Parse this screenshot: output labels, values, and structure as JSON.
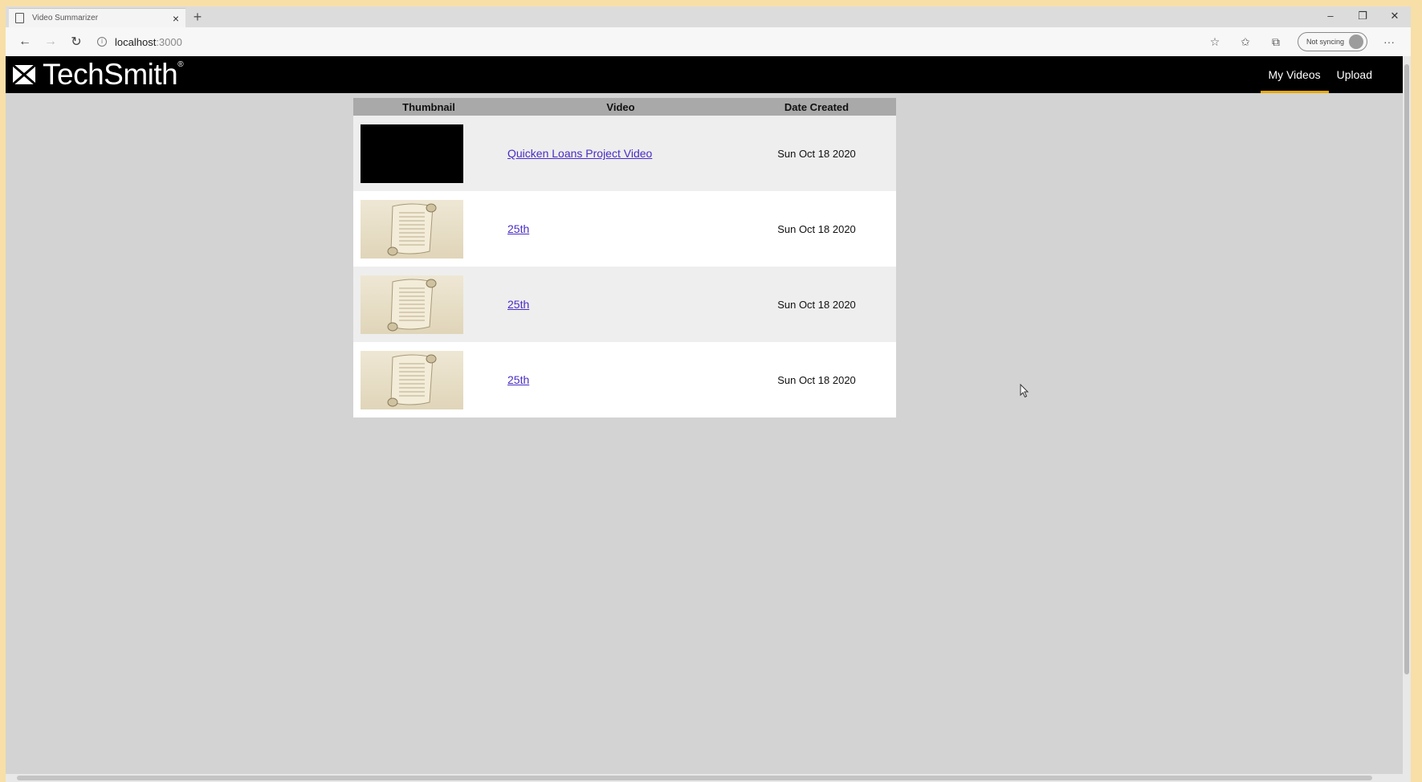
{
  "browser": {
    "tab_title": "Video Summarizer",
    "url_host": "localhost",
    "url_port": ":3000",
    "sync_label": "Not syncing",
    "tab_close_glyph": "×",
    "new_tab_glyph": "+",
    "back_glyph": "←",
    "forward_glyph": "→",
    "refresh_glyph": "↻",
    "star_glyph": "☆",
    "favorites_glyph": "✩",
    "collections_glyph": "⧉",
    "more_glyph": "···",
    "minimize_glyph": "–",
    "maximize_glyph": "❐",
    "close_glyph": "✕"
  },
  "header": {
    "logo_text": "TechSmith",
    "logo_reg": "®",
    "nav": [
      {
        "label": "My Videos",
        "active": true
      },
      {
        "label": "Upload",
        "active": false
      }
    ]
  },
  "table": {
    "columns": [
      "Thumbnail",
      "Video",
      "Date Created"
    ],
    "rows": [
      {
        "thumbnail": "black",
        "video": "Quicken Loans Project Video",
        "date": "Sun Oct 18 2020"
      },
      {
        "thumbnail": "scroll",
        "video": "25th",
        "date": "Sun Oct 18 2020"
      },
      {
        "thumbnail": "scroll",
        "video": "25th",
        "date": "Sun Oct 18 2020"
      },
      {
        "thumbnail": "scroll",
        "video": "25th",
        "date": "Sun Oct 18 2020"
      }
    ]
  },
  "colors": {
    "header_bg": "#000000",
    "nav_active_underline": "#e8a800",
    "page_bg": "#d3d3d3",
    "link": "#4a2cc6"
  }
}
